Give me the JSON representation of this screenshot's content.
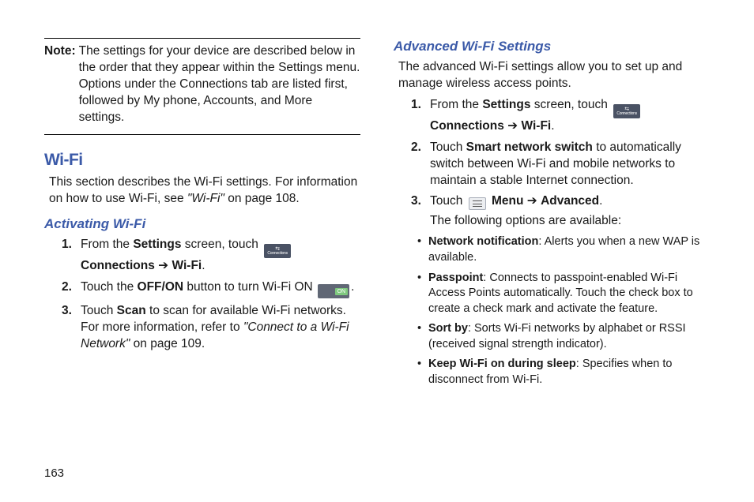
{
  "page_number": "163",
  "left": {
    "note_label": "Note:",
    "note_text": "The settings for your device are described below in the order that they appear within the Settings menu. Options under the Connections tab are listed first, followed by My phone, Accounts, and More settings.",
    "h2": "Wi-Fi",
    "intro1": "This section describes the Wi-Fi settings. For information on how to use Wi-Fi, see ",
    "intro_ref": "\"Wi-Fi\"",
    "intro2": " on page 108.",
    "h3": "Activating Wi-Fi",
    "connections_icon_label": "Connections",
    "step1_a": "From the ",
    "step1_b": "Settings",
    "step1_c": " screen, touch ",
    "step1_d": "Connections",
    "step1_e": " ➔ ",
    "step1_f": "Wi-Fi",
    "step1_g": ".",
    "step2_a": "Touch the ",
    "step2_b": "OFF/ON",
    "step2_c": " button to turn Wi-Fi ON ",
    "step2_d": ".",
    "on_label": "ON",
    "step3_a": "Touch ",
    "step3_b": "Scan",
    "step3_c": " to scan for available Wi-Fi networks. For more information, refer to ",
    "step3_ref": "\"Connect to a Wi-Fi Network\"",
    "step3_d": "  on page 109."
  },
  "right": {
    "h3": "Advanced Wi-Fi Settings",
    "intro": "The advanced Wi-Fi settings allow you to set up and manage wireless access points.",
    "step1_a": "From the ",
    "step1_b": "Settings",
    "step1_c": " screen, touch ",
    "step1_d": "Connections",
    "step1_e": " ➔ ",
    "step1_f": "Wi-Fi",
    "step1_g": ".",
    "step2_a": "Touch ",
    "step2_b": "Smart network switch",
    "step2_c": " to automatically switch between Wi-Fi and mobile networks to maintain a stable Internet connection.",
    "step3_a": "Touch ",
    "step3_b": "Menu",
    "step3_c": " ➔ ",
    "step3_d": "Advanced",
    "step3_e": ".",
    "step3_f": "The following options are available:",
    "b1_t": "Network notification",
    "b1_d": ": Alerts you when a new WAP is available.",
    "b2_t": "Passpoint",
    "b2_d": ": Connects to passpoint-enabled Wi-Fi Access Points automatically. Touch the check box to create a check mark and activate the feature.",
    "b3_t": "Sort by",
    "b3_d": ": Sorts Wi-Fi networks by alphabet or RSSI (received signal strength indicator).",
    "b4_t": "Keep Wi-Fi on during sleep",
    "b4_d": ": Specifies when to disconnect from Wi-Fi."
  }
}
